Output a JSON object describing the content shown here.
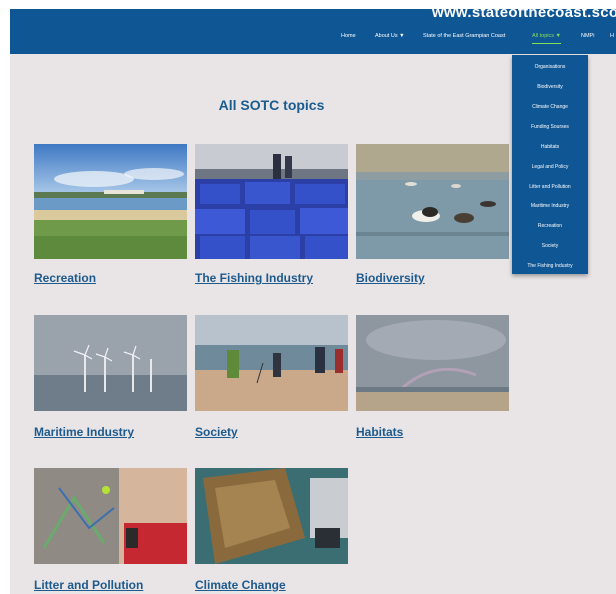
{
  "site": {
    "title": "www.stateofthecoast.sco"
  },
  "nav": {
    "items": [
      {
        "label": "Home"
      },
      {
        "label": "About Us ▼"
      },
      {
        "label": "State of the East Grampian Coast"
      },
      {
        "label": "All topics ▼"
      },
      {
        "label": "NMPi"
      },
      {
        "label": "H"
      }
    ]
  },
  "topics_menu": {
    "items": [
      "Organisations",
      "Biodiversity",
      "Climate Change",
      "Funding Sourses",
      "Habitats",
      "Legal and Policy",
      "Litter and Pollution",
      "Maritime Industry",
      "Recreation",
      "Society",
      "The Fishing Industry"
    ]
  },
  "main": {
    "heading": "All SOTC topics",
    "topics": [
      {
        "label": "Recreation"
      },
      {
        "label": "The Fishing Industry"
      },
      {
        "label": "Biodiversity"
      },
      {
        "label": "Maritime Industry"
      },
      {
        "label": "Society"
      },
      {
        "label": "Habitats"
      },
      {
        "label": "Litter and Pollution"
      },
      {
        "label": "Climate Change"
      }
    ]
  },
  "colors": {
    "header_bg": "#0f5694",
    "page_bg": "#e9e5e6",
    "link": "#1d5a8e",
    "active_nav": "#86e05a"
  }
}
